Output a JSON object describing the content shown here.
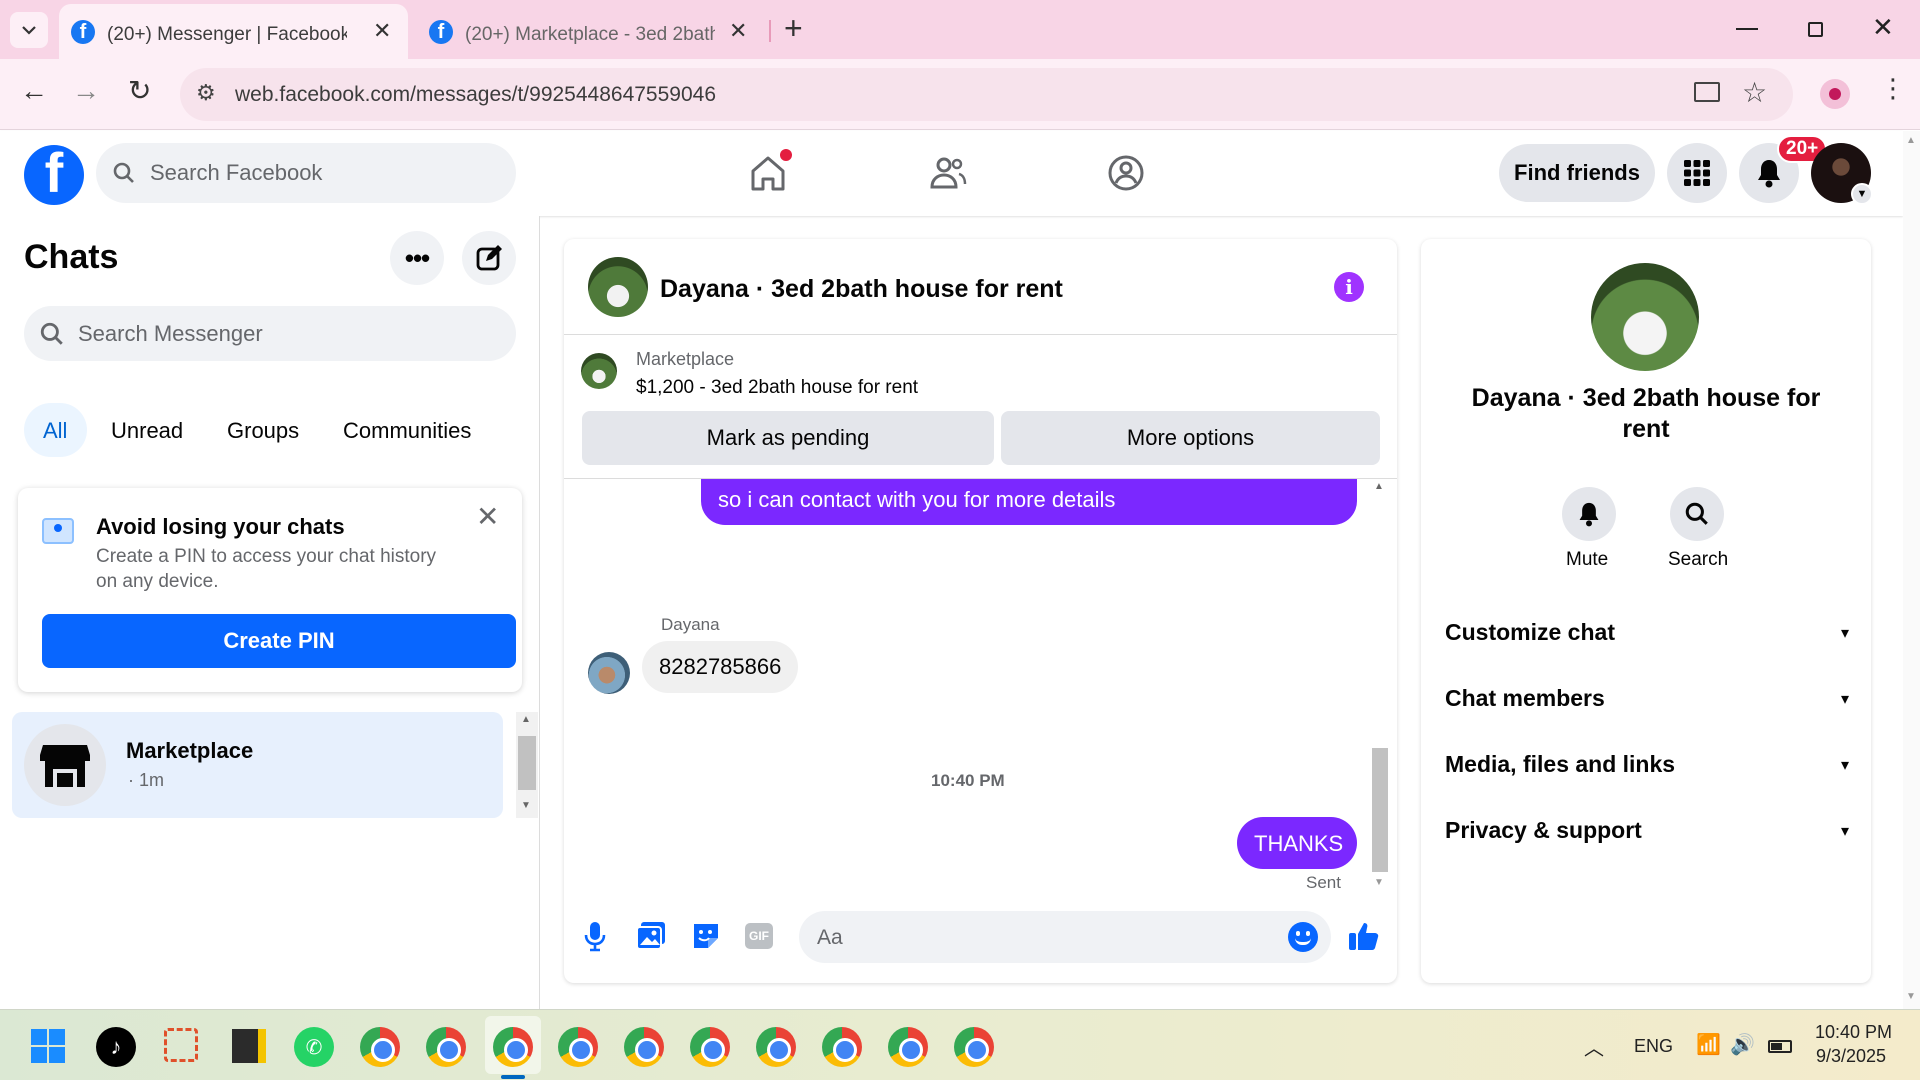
{
  "browser": {
    "tabs": [
      {
        "title": "(20+) Messenger | Facebook",
        "active": true
      },
      {
        "title": "(20+) Marketplace - 3ed 2bath",
        "active": false
      }
    ],
    "new_tab": "+",
    "url": "web.facebook.com/messages/t/9925448647559046"
  },
  "header": {
    "logo": "f",
    "search_placeholder": "Search Facebook",
    "find_friends": "Find friends",
    "notif_badge": "20+"
  },
  "chats": {
    "title": "Chats",
    "search_placeholder": "Search Messenger",
    "filters": [
      "All",
      "Unread",
      "Groups",
      "Communities"
    ],
    "pin_card": {
      "title": "Avoid losing your chats",
      "body": "Create a PIN to access your chat history on any device.",
      "button": "Create PIN"
    },
    "items": [
      {
        "name": "Marketplace",
        "meta": "· 1m"
      }
    ]
  },
  "conversation": {
    "title": "Dayana · 3ed 2bath house for rent",
    "listing": {
      "label": "Marketplace",
      "detail": "$1,200 - 3ed 2bath house for rent"
    },
    "mark_pending": "Mark as pending",
    "more_options": "More options",
    "messages": {
      "out1": "so i can contact with you for more details",
      "sender": "Dayana",
      "in1": "8282785866",
      "timestamp": "10:40 PM",
      "out2": "THANKS",
      "status": "Sent"
    },
    "composer_placeholder": "Aa",
    "gif_label": "GIF"
  },
  "details": {
    "name": "Dayana · 3ed 2bath house for rent",
    "actions": {
      "mute": "Mute",
      "search": "Search"
    },
    "sections": [
      "Customize chat",
      "Chat members",
      "Media, files and links",
      "Privacy & support"
    ]
  },
  "taskbar": {
    "lang": "ENG",
    "time": "10:40 PM",
    "date": "9/3/2025"
  },
  "colors": {
    "fb_blue": "#0866ff",
    "bubble_purple": "#7b28ff",
    "info_purple": "#a033ff",
    "badge_red": "#e41e3f"
  }
}
